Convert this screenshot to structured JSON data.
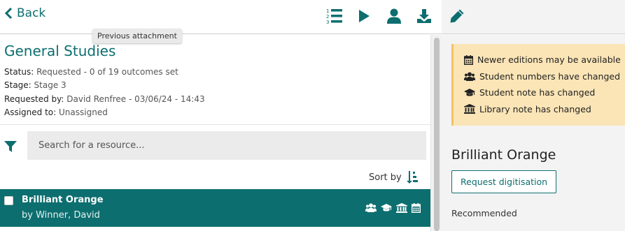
{
  "toolbar": {
    "back_label": "Back",
    "tooltip": "Previous attachment",
    "icons": [
      "ordered-list-icon",
      "play-icon",
      "user-icon",
      "download-icon",
      "pencil-icon"
    ]
  },
  "list": {
    "title": "General Studies",
    "status_label": "Status:",
    "status_value": "Requested - 0 of 19 outcomes set",
    "stage_label": "Stage:",
    "stage_value": "Stage 3",
    "requested_label": "Requested by:",
    "requested_value": "David Renfree - 03/06/24 - 14:43",
    "assigned_label": "Assigned to:",
    "assigned_value": "Unassigned",
    "search_placeholder": "Search for a resource...",
    "sort_label": "Sort by",
    "items": [
      {
        "title": "Brilliant Orange",
        "author": "by Winner, David",
        "icons": [
          "users-icon",
          "graduation-cap-icon",
          "library-icon",
          "calendar-icon"
        ]
      }
    ]
  },
  "detail": {
    "notices": [
      {
        "icon": "calendar-icon",
        "text": "Newer editions may be available"
      },
      {
        "icon": "users-icon",
        "text": "Student numbers have changed"
      },
      {
        "icon": "graduation-cap-icon",
        "text": "Student note has changed"
      },
      {
        "icon": "library-icon",
        "text": "Library note has changed"
      }
    ],
    "title": "Brilliant Orange",
    "request_button": "Request digitisation",
    "section": "Recommended"
  },
  "colors": {
    "accent": "#0d6e6f",
    "notice_bg": "#fbe5b6",
    "notice_border": "#f1c364",
    "panel_bg": "#f3f3f3"
  }
}
